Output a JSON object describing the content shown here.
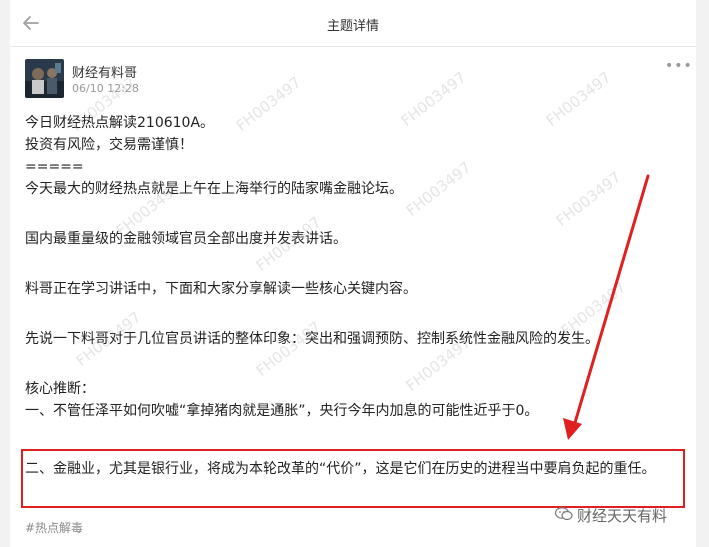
{
  "header": {
    "title": "主题详情"
  },
  "post": {
    "author": "财经有料哥",
    "time": "06/10 12:28",
    "lines": [
      "今日财经热点解读210610A。",
      "投资有风险，交易需谨慎！",
      "=====",
      "今天最大的财经热点就是上午在上海举行的陆家嘴金融论坛。",
      "国内最重量级的金融领域官员全部出度并发表讲话。",
      "料哥正在学习讲话中，下面和大家分享解读一些核心关键内容。",
      "先说一下料哥对于几位官员讲话的整体印象：突出和强调预防、控制系统性金融风险的发生。",
      "核心推断：",
      "一、不管任泽平如何吹嘘“拿掉猪肉就是通胀”，央行今年内加息的可能性近乎于0。"
    ],
    "highlight": "二、金融业，尤其是银行业，将成为本轮改革的“代价”，这是它们在历史的进程当中要肩负起的重任。",
    "tag": "#热点解毒"
  },
  "watermark": "FH003497",
  "brand": "财经天天有料",
  "colors": {
    "highlight_border": "#e02020",
    "arrow": "#e02020"
  }
}
